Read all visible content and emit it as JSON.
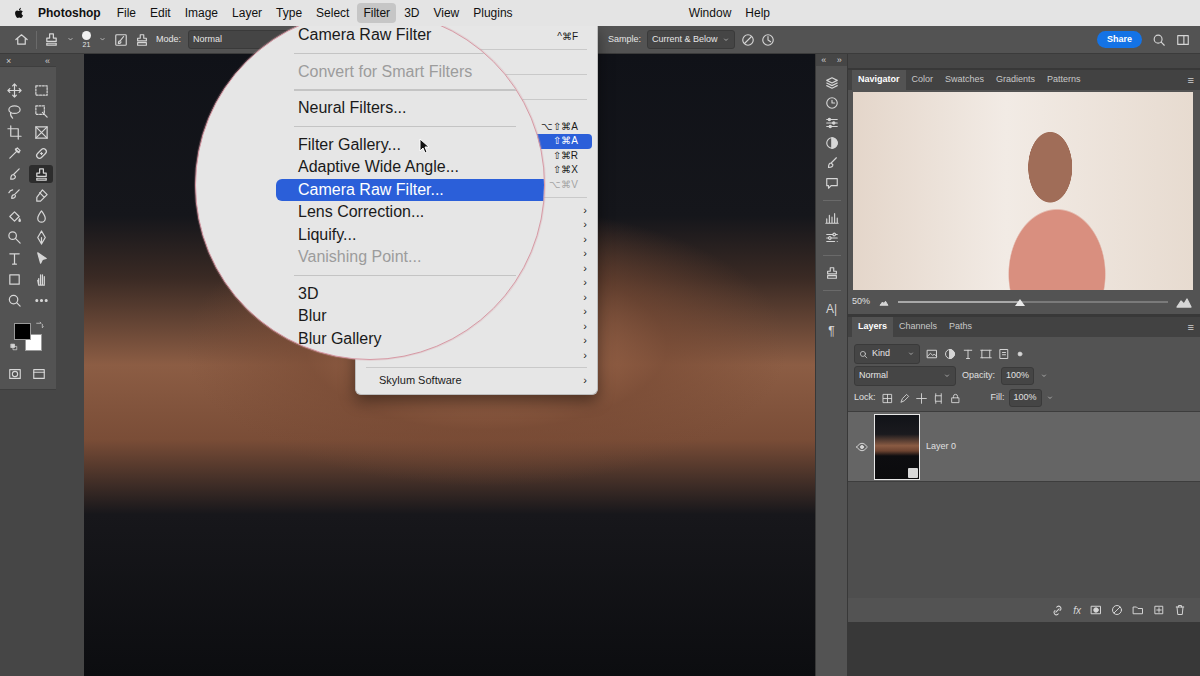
{
  "menubar": {
    "app": "Photoshop",
    "items": [
      {
        "label": "File",
        "selected": false
      },
      {
        "label": "Edit",
        "selected": false
      },
      {
        "label": "Image",
        "selected": false
      },
      {
        "label": "Layer",
        "selected": false
      },
      {
        "label": "Type",
        "selected": false
      },
      {
        "label": "Select",
        "selected": false
      },
      {
        "label": "Filter",
        "selected": true
      },
      {
        "label": "3D",
        "selected": false
      },
      {
        "label": "View",
        "selected": false
      },
      {
        "label": "Plugins",
        "selected": false
      }
    ],
    "right_items": [
      {
        "label": "Window",
        "selected": false
      },
      {
        "label": "Help",
        "selected": false
      }
    ]
  },
  "options_bar": {
    "brush_size": "21",
    "mode_label": "Mode:",
    "mode_value": "Normal",
    "sample_label": "Sample:",
    "sample_value": "Current & Below",
    "share": "Share"
  },
  "toolbar": {
    "close": "×",
    "collapse": "«",
    "tools": [
      {
        "selected": false
      },
      {
        "selected": false
      },
      {
        "selected": false
      },
      {
        "selected": false
      },
      {
        "selected": false
      },
      {
        "selected": false
      },
      {
        "selected": false
      },
      {
        "selected": false
      },
      {
        "selected": false
      },
      {
        "selected": true
      },
      {
        "selected": false
      },
      {
        "selected": false
      },
      {
        "selected": false
      },
      {
        "selected": false
      },
      {
        "selected": false
      },
      {
        "selected": false
      },
      {
        "selected": false
      },
      {
        "selected": false
      },
      {
        "selected": false
      },
      {
        "selected": false
      },
      {
        "selected": false
      },
      {
        "selected": false
      }
    ],
    "foreground": "#000000",
    "background": "#ffffff"
  },
  "filter_menu": {
    "rows": [
      {
        "kind": "item",
        "shortcut": "^⌘F",
        "arrow": "",
        "disabled": false,
        "selected": false
      },
      {
        "kind": "separator"
      },
      {
        "kind": "item",
        "shortcut": "",
        "arrow": "",
        "disabled": true,
        "selected": false
      },
      {
        "kind": "separator"
      },
      {
        "kind": "item",
        "shortcut": "",
        "arrow": "",
        "disabled": false,
        "selected": false
      },
      {
        "kind": "separator"
      },
      {
        "kind": "item",
        "shortcut": "",
        "arrow": "",
        "disabled": false,
        "selected": false
      },
      {
        "kind": "item",
        "shortcut": "⌥⇧⌘A",
        "arrow": "",
        "disabled": false,
        "selected": false
      },
      {
        "kind": "item",
        "shortcut": "⇧⌘A",
        "arrow": "",
        "disabled": false,
        "selected": true
      },
      {
        "kind": "item",
        "shortcut": "⇧⌘R",
        "arrow": "",
        "disabled": false,
        "selected": false
      },
      {
        "kind": "item",
        "shortcut": "⇧⌘X",
        "arrow": "",
        "disabled": false,
        "selected": false
      },
      {
        "kind": "item",
        "shortcut": "⌥⌘V",
        "arrow": "",
        "disabled": true,
        "selected": false
      },
      {
        "kind": "separator"
      },
      {
        "kind": "item",
        "shortcut": "",
        "arrow": "›",
        "disabled": false,
        "selected": false
      },
      {
        "kind": "item",
        "shortcut": "",
        "arrow": "›",
        "disabled": false,
        "selected": false
      },
      {
        "kind": "item",
        "shortcut": "",
        "arrow": "›",
        "disabled": false,
        "selected": false
      },
      {
        "kind": "item",
        "shortcut": "",
        "arrow": "›",
        "disabled": false,
        "selected": false
      },
      {
        "kind": "item",
        "shortcut": "",
        "arrow": "›",
        "disabled": false,
        "selected": false
      },
      {
        "kind": "item",
        "shortcut": "",
        "arrow": "›",
        "disabled": false,
        "selected": false
      },
      {
        "kind": "item",
        "shortcut": "",
        "arrow": "›",
        "disabled": false,
        "selected": false
      },
      {
        "kind": "item",
        "shortcut": "",
        "arrow": "›",
        "disabled": false,
        "selected": false
      },
      {
        "kind": "item",
        "shortcut": "",
        "arrow": "›",
        "disabled": false,
        "selected": false
      },
      {
        "kind": "item",
        "shortcut": "",
        "arrow": "›",
        "disabled": false,
        "selected": false
      },
      {
        "kind": "item",
        "shortcut": "",
        "arrow": "›",
        "disabled": false,
        "selected": false
      },
      {
        "kind": "separator"
      }
    ],
    "footer": {
      "label": "Skylum Software",
      "arrow": "›",
      "selected": false
    }
  },
  "magnifier": {
    "items": [
      {
        "kind": "item",
        "label": "Camera Raw Filter",
        "disabled": false,
        "selected": false
      },
      {
        "kind": "separator"
      },
      {
        "kind": "item",
        "label": "Convert for Smart Filters",
        "disabled": true,
        "selected": false
      },
      {
        "kind": "separator"
      },
      {
        "kind": "item",
        "label": "Neural Filters...",
        "disabled": false,
        "selected": false
      },
      {
        "kind": "separator"
      },
      {
        "kind": "item",
        "label": "Filter Gallery...",
        "disabled": false,
        "selected": false
      },
      {
        "kind": "item",
        "label": "Adaptive Wide Angle...",
        "disabled": false,
        "selected": false
      },
      {
        "kind": "item",
        "label": "Camera Raw Filter...",
        "disabled": false,
        "selected": true
      },
      {
        "kind": "item",
        "label": "Lens Correction...",
        "disabled": false,
        "selected": false
      },
      {
        "kind": "item",
        "label": "Liquify...",
        "disabled": false,
        "selected": false
      },
      {
        "kind": "item",
        "label": "Vanishing Point...",
        "disabled": true,
        "selected": false
      },
      {
        "kind": "separator"
      },
      {
        "kind": "item",
        "label": "3D",
        "disabled": false,
        "selected": false
      },
      {
        "kind": "item",
        "label": "Blur",
        "disabled": false,
        "selected": false
      },
      {
        "kind": "item",
        "label": "Blur Gallery",
        "disabled": false,
        "selected": false
      }
    ]
  },
  "side_strip": {
    "collapse": "«",
    "expand": "»",
    "text_icons": [
      "A|",
      "¶"
    ]
  },
  "navigator": {
    "tabs": [
      {
        "label": "Navigator",
        "selected": true
      },
      {
        "label": "Color",
        "selected": false
      },
      {
        "label": "Swatches",
        "selected": false
      },
      {
        "label": "Gradients",
        "selected": false
      },
      {
        "label": "Patterns",
        "selected": false
      }
    ],
    "menu": "≡",
    "zoom": "50%",
    "level": 0.45
  },
  "layers": {
    "tabs": [
      {
        "label": "Layers",
        "selected": true
      },
      {
        "label": "Channels",
        "selected": false
      },
      {
        "label": "Paths",
        "selected": false
      }
    ],
    "menu": "≡",
    "filter_kind": "Kind",
    "blend_mode": "Normal",
    "opacity_label": "Opacity:",
    "opacity": "100%",
    "lock_label": "Lock:",
    "fill_label": "Fill:",
    "fill": "100%",
    "rows": [
      {
        "name": "Layer 0",
        "visible": true,
        "selected": true
      }
    ],
    "footer_fx": "fx"
  }
}
